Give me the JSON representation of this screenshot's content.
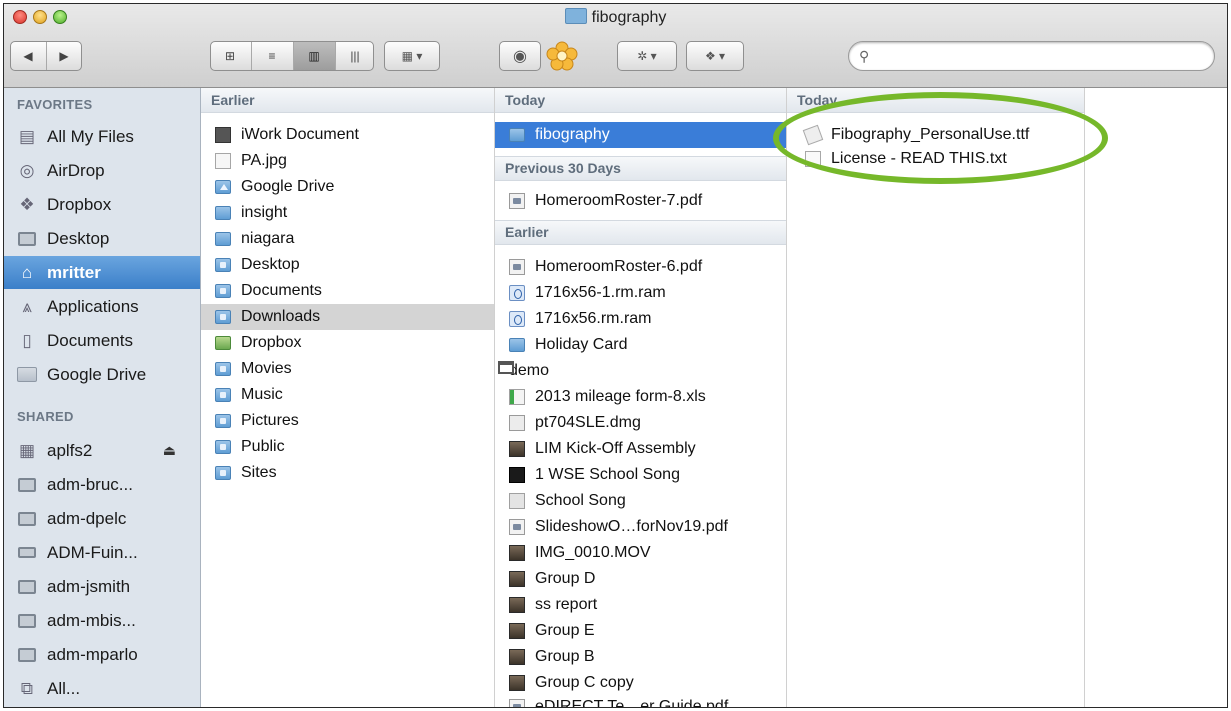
{
  "window": {
    "title": "fibography"
  },
  "toolbar": {
    "back_glyph": "◀",
    "forward_glyph": "▶",
    "view_icons": "⊞",
    "view_list": "≡",
    "view_columns": "▥",
    "view_coverflow": "|||",
    "arrange_glyph": "▦ ▾",
    "quicklook_glyph": "◉",
    "action_glyph": "✲ ▾",
    "dropbox_glyph": "❖ ▾",
    "search_placeholder": ""
  },
  "sidebar": {
    "favorites_header": "FAVORITES",
    "favorites": [
      {
        "label": "All My Files",
        "icon": "all-files-icon"
      },
      {
        "label": "AirDrop",
        "icon": "airdrop-icon"
      },
      {
        "label": "Dropbox",
        "icon": "dropbox-icon"
      },
      {
        "label": "Desktop",
        "icon": "desktop-icon"
      },
      {
        "label": "mritter",
        "icon": "home-icon"
      },
      {
        "label": "Applications",
        "icon": "applications-icon"
      },
      {
        "label": "Documents",
        "icon": "documents-icon"
      },
      {
        "label": "Google Drive",
        "icon": "folder-icon"
      }
    ],
    "shared_header": "SHARED",
    "shared": [
      {
        "label": "aplfs2",
        "icon": "server-icon",
        "eject": "⏏"
      },
      {
        "label": "adm-bruc...",
        "icon": "computer-icon"
      },
      {
        "label": "adm-dpelc",
        "icon": "computer-icon"
      },
      {
        "label": "ADM-Fuin...",
        "icon": "laptop-icon"
      },
      {
        "label": "adm-jsmith",
        "icon": "computer-icon"
      },
      {
        "label": "adm-mbis...",
        "icon": "computer-icon"
      },
      {
        "label": "adm-mparlo",
        "icon": "computer-icon"
      },
      {
        "label": "All...",
        "icon": "network-icon"
      }
    ]
  },
  "columns": {
    "col1": {
      "header": "Earlier",
      "items": [
        {
          "label": "iWork Document",
          "icon": "iwork"
        },
        {
          "label": "PA.jpg",
          "icon": "doc"
        },
        {
          "label": "Google Drive",
          "icon": "gdrive"
        },
        {
          "label": "insight",
          "icon": "folder"
        },
        {
          "label": "niagara",
          "icon": "folder"
        },
        {
          "label": "Desktop",
          "icon": "special"
        },
        {
          "label": "Documents",
          "icon": "special"
        },
        {
          "label": "Downloads",
          "icon": "special"
        },
        {
          "label": "Dropbox",
          "icon": "dropbox"
        },
        {
          "label": "Movies",
          "icon": "special"
        },
        {
          "label": "Music",
          "icon": "special"
        },
        {
          "label": "Pictures",
          "icon": "special"
        },
        {
          "label": "Public",
          "icon": "special"
        },
        {
          "label": "Sites",
          "icon": "special"
        }
      ]
    },
    "col2": {
      "header_today": "Today",
      "today_item": "fibography",
      "header_prev30": "Previous 30 Days",
      "prev30_item": "HomeroomRoster-7.pdf",
      "header_earlier": "Earlier",
      "earlier_items": [
        {
          "label": "HomeroomRoster-6.pdf",
          "icon": "pdf"
        },
        {
          "label": "1716x56-1.rm.ram",
          "icon": "ram"
        },
        {
          "label": "1716x56.rm.ram",
          "icon": "ram"
        },
        {
          "label": "Holiday Card",
          "icon": "folder"
        },
        {
          "label": "demo",
          "icon": "window"
        },
        {
          "label": "2013 mileage form-8.xls",
          "icon": "xls"
        },
        {
          "label": "pt704SLE.dmg",
          "icon": "dmg"
        },
        {
          "label": "LIM Kick-Off Assembly",
          "icon": "img"
        },
        {
          "label": "1 WSE School Song",
          "icon": "music"
        },
        {
          "label": "School Song",
          "icon": "gray"
        },
        {
          "label": "SlideshowO…forNov19.pdf",
          "icon": "pdf"
        },
        {
          "label": "IMG_0010.MOV",
          "icon": "img"
        },
        {
          "label": "Group D",
          "icon": "img"
        },
        {
          "label": "ss report",
          "icon": "img"
        },
        {
          "label": "Group E",
          "icon": "img"
        },
        {
          "label": "Group B",
          "icon": "img"
        },
        {
          "label": "Group C copy",
          "icon": "img"
        },
        {
          "label": "eDIRECT Te…er Guide.pdf",
          "icon": "pdf"
        }
      ]
    },
    "col3": {
      "header": "Today",
      "items": [
        {
          "label": "Fibography_PersonalUse.ttf",
          "icon": "font"
        },
        {
          "label": "License - READ THIS.txt",
          "icon": "txt"
        }
      ]
    }
  },
  "annotation": {
    "highlight_color": "#76b82a"
  }
}
